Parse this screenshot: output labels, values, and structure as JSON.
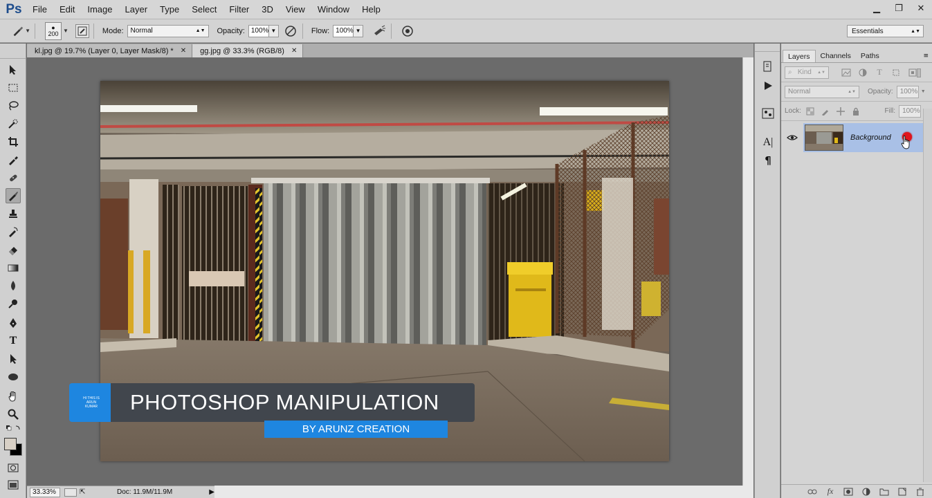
{
  "app": {
    "logo": "Ps",
    "menu": [
      "File",
      "Edit",
      "Image",
      "Layer",
      "Type",
      "Select",
      "Filter",
      "3D",
      "View",
      "Window",
      "Help"
    ]
  },
  "options": {
    "brush_size": "200",
    "mode_label": "Mode:",
    "mode_value": "Normal",
    "opacity_label": "Opacity:",
    "opacity_value": "100%",
    "flow_label": "Flow:",
    "flow_value": "100%",
    "workspace": "Essentials"
  },
  "tabs": [
    {
      "label": "kl.jpg @ 19.7% (Layer 0, Layer Mask/8) *",
      "active": false
    },
    {
      "label": "gg.jpg @ 33.3% (RGB/8)",
      "active": true
    }
  ],
  "overlay": {
    "small_lines": [
      "HI THIS IS",
      "ARUN",
      "KUMAR"
    ],
    "title": "PHOTOSHOP MANIPULATION",
    "subtitle": "BY ARUNZ CREATION"
  },
  "status": {
    "zoom": "33.33%",
    "doc": "Doc: 11.9M/11.9M"
  },
  "layers_panel": {
    "tabs": [
      "Layers",
      "Channels",
      "Paths"
    ],
    "filter_kind": "Kind",
    "blend_mode": "Normal",
    "opacity_label": "Opacity:",
    "opacity_value": "100%",
    "lock_label": "Lock:",
    "fill_label": "Fill:",
    "fill_value": "100%",
    "layer_name": "Background"
  },
  "colors": {
    "accent_blue": "#1e86e0",
    "overlay_dark": "#41464d",
    "layer_selected": "#a9c0e6",
    "lock_red": "#e0141c"
  }
}
